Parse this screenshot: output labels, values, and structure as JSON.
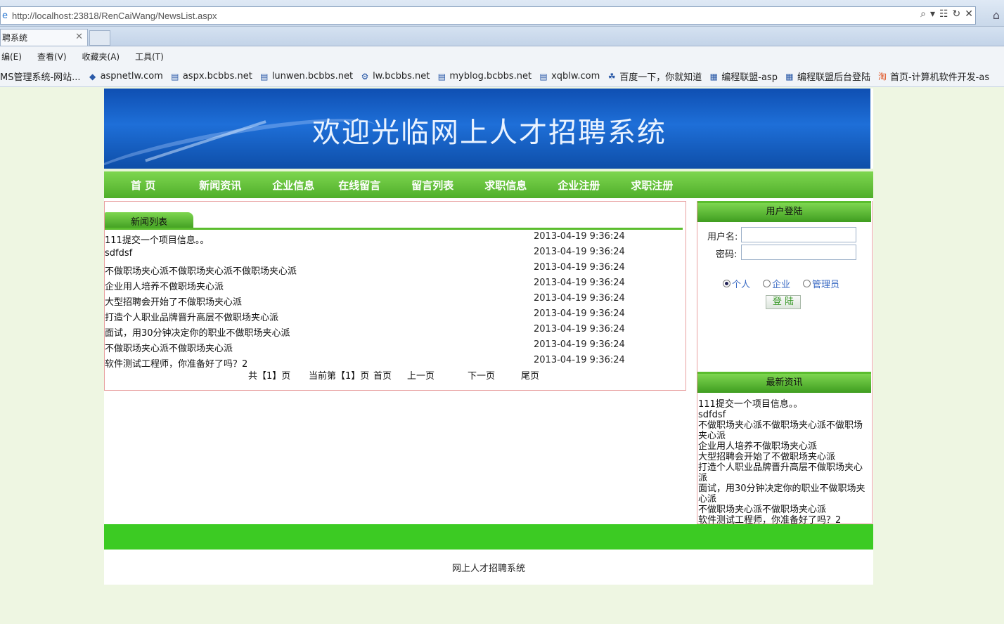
{
  "browser": {
    "url": "http://localhost:23818/RenCaiWang/NewsList.aspx",
    "tab_title": "聘系统",
    "menu": [
      "编(E)",
      "查看(V)",
      "收藏夹(A)",
      "工具(T)"
    ],
    "favorites": [
      {
        "icon": "page-icon",
        "label": "MS管理系统-网站..."
      },
      {
        "icon": "site-icon",
        "label": "aspnetlw.com"
      },
      {
        "icon": "page-icon",
        "label": "aspx.bcbbs.net"
      },
      {
        "icon": "page-icon",
        "label": "lunwen.bcbbs.net"
      },
      {
        "icon": "site-icon",
        "label": "lw.bcbbs.net"
      },
      {
        "icon": "page-icon",
        "label": "myblog.bcbbs.net"
      },
      {
        "icon": "page-icon",
        "label": "xqblw.com"
      },
      {
        "icon": "baidu-icon",
        "label": "百度一下，你就知道"
      },
      {
        "icon": "forum-icon",
        "label": "编程联盟-asp"
      },
      {
        "icon": "forum-icon",
        "label": "编程联盟后台登陆"
      },
      {
        "icon": "taobao-icon",
        "label": "首页-计算机软件开发-as"
      }
    ]
  },
  "site": {
    "banner_title": "欢迎光临网上人才招聘系统",
    "nav": [
      "首  页",
      "新闻资讯",
      "企业信息",
      "在线留言",
      "留言列表",
      "求职信息",
      "企业注册",
      "求职注册"
    ],
    "news_tab": "新闻列表",
    "news": [
      {
        "title": "111提交一个项目信息。。",
        "date": "2013-04-19 9:36:24"
      },
      {
        "title": "sdfdsf",
        "date": "2013-04-19 9:36:24"
      },
      {
        "title": "不做职场夹心派不做职场夹心派不做职场夹心派",
        "date": "2013-04-19 9:36:24"
      },
      {
        "title": "企业用人培养不做职场夹心派",
        "date": "2013-04-19 9:36:24"
      },
      {
        "title": "大型招聘会开始了不做职场夹心派",
        "date": "2013-04-19 9:36:24"
      },
      {
        "title": "打造个人职业品牌晋升高层不做职场夹心派",
        "date": "2013-04-19 9:36:24"
      },
      {
        "title": "面试，用30分钟决定你的职业不做职场夹心派",
        "date": "2013-04-19 9:36:24"
      },
      {
        "title": "不做职场夹心派不做职场夹心派",
        "date": "2013-04-19 9:36:24"
      },
      {
        "title": "软件测试工程师，你准备好了吗？2",
        "date": "2013-04-19 9:36:24"
      }
    ],
    "pager": {
      "total": "共【1】页",
      "current": "当前第【1】页",
      "first": "首页",
      "prev": "上一页",
      "next": "下一页",
      "last": "尾页"
    },
    "login": {
      "header": "用户登陆",
      "username_label": "用户名:",
      "password_label": "密码:",
      "roles": [
        "个人",
        "企业",
        "管理员"
      ],
      "selected_role": "个人",
      "submit": "登 陆"
    },
    "latest_header": "最新资讯",
    "latest": [
      "111提交一个项目信息。。",
      "sdfdsf",
      "不做职场夹心派不做职场夹心派不做职场夹心派",
      "企业用人培养不做职场夹心派",
      "大型招聘会开始了不做职场夹心派",
      "打造个人职业品牌晋升高层不做职场夹心派",
      "面试，用30分钟决定你的职业不做职场夹心派",
      "不做职场夹心派不做职场夹心派",
      "软件测试工程师，你准备好了吗？2"
    ],
    "footer": "网上人才招聘系统"
  }
}
